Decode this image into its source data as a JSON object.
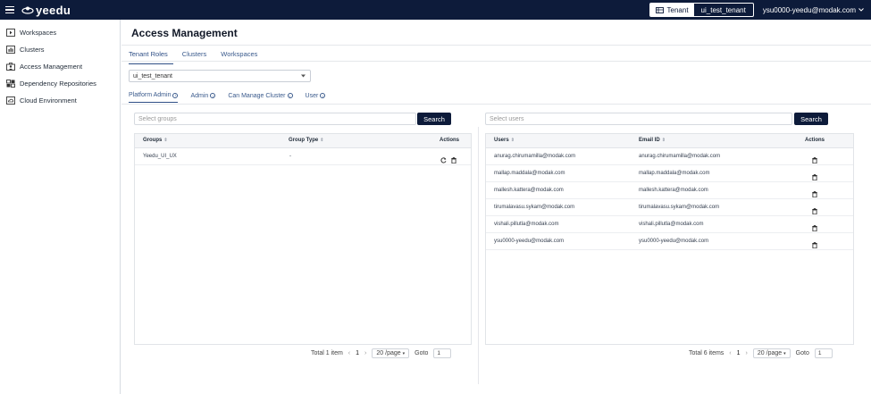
{
  "header": {
    "logo_text": "yeedu",
    "tenant_button": "Tenant",
    "tenant_name": "ui_test_tenant",
    "user_email": "ysu0000-yeedu@modak.com"
  },
  "sidebar": {
    "items": [
      {
        "label": "Workspaces",
        "icon": "workspace-icon"
      },
      {
        "label": "Clusters",
        "icon": "cluster-icon"
      },
      {
        "label": "Access Management",
        "icon": "access-icon"
      },
      {
        "label": "Dependency Repositories",
        "icon": "repository-icon"
      },
      {
        "label": "Cloud Environment",
        "icon": "cloud-icon"
      }
    ]
  },
  "main": {
    "title": "Access Management",
    "tabs": [
      {
        "label": "Tenant Roles",
        "active": true
      },
      {
        "label": "Clusters",
        "active": false
      },
      {
        "label": "Workspaces",
        "active": false
      }
    ],
    "tenant_select": "ui_test_tenant",
    "subtabs": [
      {
        "label": "Platform Admin",
        "active": true
      },
      {
        "label": "Admin",
        "active": false
      },
      {
        "label": "Can Manage Cluster",
        "active": false
      },
      {
        "label": "User",
        "active": false
      }
    ]
  },
  "groups_panel": {
    "search_placeholder": "Select groups",
    "search_button": "Search",
    "columns": [
      "Groups",
      "Group Type",
      "Actions"
    ],
    "rows": [
      {
        "group": "Yeedu_UI_UX",
        "type": "-"
      }
    ],
    "pager": {
      "total": "Total 1 item",
      "page": "1",
      "size": "20 /page",
      "goto_label": "Goto",
      "goto_value": "1"
    }
  },
  "users_panel": {
    "search_placeholder": "Select users",
    "search_button": "Search",
    "columns": [
      "Users",
      "Email ID",
      "Actions"
    ],
    "rows": [
      {
        "user": "anurag.chirumamilla@modak.com",
        "email": "anurag.chirumamilla@modak.com"
      },
      {
        "user": "mallap.maddala@modak.com",
        "email": "mallap.maddala@modak.com"
      },
      {
        "user": "mallesh.kattera@modak.com",
        "email": "mallesh.kattera@modak.com"
      },
      {
        "user": "tirumalavasu.sykam@modak.com",
        "email": "tirumalavasu.sykam@modak.com"
      },
      {
        "user": "vishali.pillutla@modak.com",
        "email": "vishali.pillutla@modak.com"
      },
      {
        "user": "ysu0000-yeedu@modak.com",
        "email": "ysu0000-yeedu@modak.com"
      }
    ],
    "pager": {
      "total": "Total 6 items",
      "page": "1",
      "size": "20 /page",
      "goto_label": "Goto",
      "goto_value": "1"
    }
  }
}
